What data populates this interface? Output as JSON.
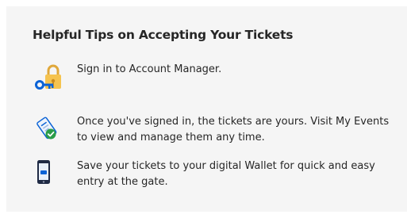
{
  "section": {
    "title": "Helpful Tips on Accepting Your Tickets"
  },
  "tips": [
    {
      "icon": "padlock-key-icon",
      "text": "Sign in to Account Manager."
    },
    {
      "icon": "ticket-check-icon",
      "text": "Once you've signed in, the tickets are yours. Visit My Events to view and manage them any time."
    },
    {
      "icon": "phone-ticket-icon",
      "text": "Save your tickets to your digital Wallet for quick and easy entry at the gate."
    }
  ],
  "colors": {
    "panel_background": "#f5f5f5",
    "text": "#262626",
    "lock_yellow": "#f5c34f",
    "key_blue": "#0b63d6",
    "check_green": "#2a9d48",
    "phone_navy": "#1f2a44"
  }
}
